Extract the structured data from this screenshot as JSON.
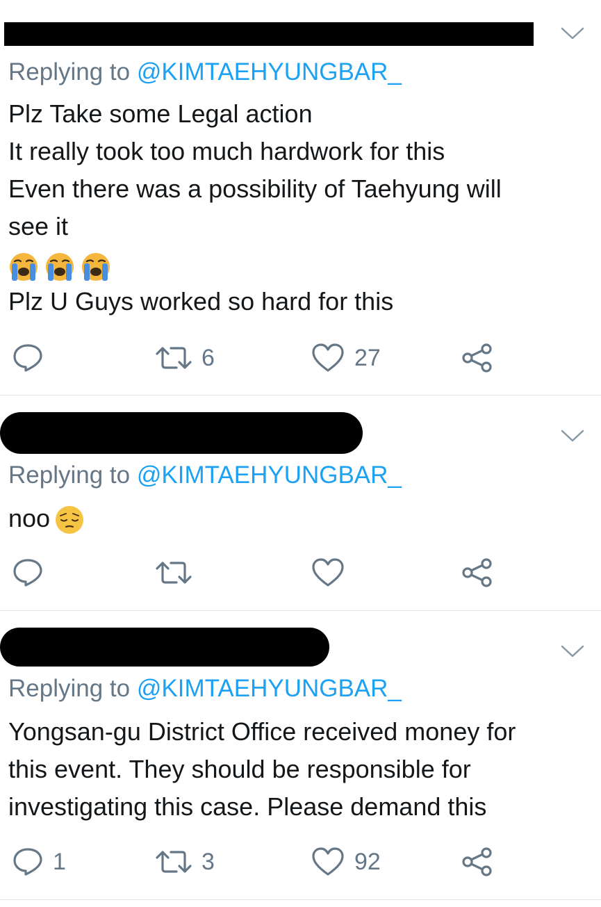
{
  "colors": {
    "text": "#14171a",
    "secondary": "#657786",
    "accent": "#1da1f2",
    "divider": "#dfe3e6",
    "redaction": "#000000"
  },
  "tweets": [
    {
      "replying_prefix": "Replying to",
      "replying_handle": "@KIMTAEHYUNGBAR_",
      "lines": [
        "Plz Take some Legal action",
        "It really took too much hardwork for this",
        "Even there was a possibility of Taehyung will",
        "see it"
      ],
      "emoji": [
        "loudly-crying-face",
        "loudly-crying-face",
        "loudly-crying-face"
      ],
      "after_emoji": "Plz U Guys worked so hard for this",
      "counts": {
        "reply": "",
        "retweet": "6",
        "like": "27"
      }
    },
    {
      "replying_prefix": "Replying to",
      "replying_handle": "@KIMTAEHYUNGBAR_",
      "text": "noo",
      "emoji": "pensive-face",
      "counts": {
        "reply": "",
        "retweet": "",
        "like": ""
      }
    },
    {
      "replying_prefix": "Replying to",
      "replying_handle": "@KIMTAEHYUNGBAR_",
      "lines": [
        "Yongsan-gu District Office received money for",
        "this event. They should be responsible for",
        "investigating this case. Please demand this"
      ],
      "counts": {
        "reply": "1",
        "retweet": "3",
        "like": "92"
      }
    }
  ],
  "icons": {
    "menu": "chevron-down-icon",
    "reply": "reply-icon",
    "retweet": "retweet-icon",
    "like": "heart-icon",
    "share": "share-icon"
  }
}
